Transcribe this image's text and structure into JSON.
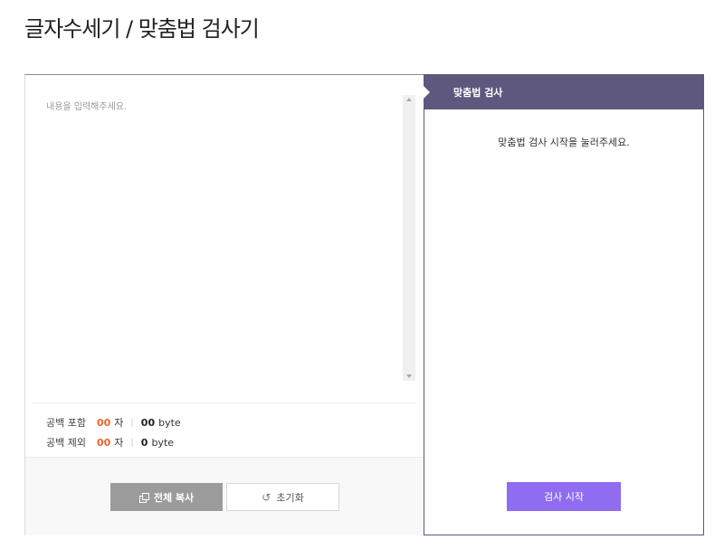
{
  "page": {
    "title": "글자수세기 / 맞춤법 검사기"
  },
  "editor": {
    "placeholder": "내용을 입력해주세요.",
    "stats": [
      {
        "label": "공백 포함",
        "chars": "00",
        "char_unit": "자",
        "bytes": "00",
        "byte_unit": "byte"
      },
      {
        "label": "공백 제외",
        "chars": "00",
        "char_unit": "자",
        "bytes": "0",
        "byte_unit": "byte"
      }
    ],
    "copy_button": {
      "label": "전체 복사",
      "icon": "copy-icon"
    },
    "reset_button": {
      "label": "초기화",
      "icon": "reset-icon"
    }
  },
  "spell_check": {
    "header": "맞춤법 검사",
    "message": "맞춤법 검사 시작을 눌러주세요.",
    "start_button": "검사 시작"
  },
  "colors": {
    "accent_orange": "#e9662f",
    "header_purple": "#5e587e",
    "button_purple": "#8f6cf0",
    "button_gray": "#9b9b9b"
  }
}
